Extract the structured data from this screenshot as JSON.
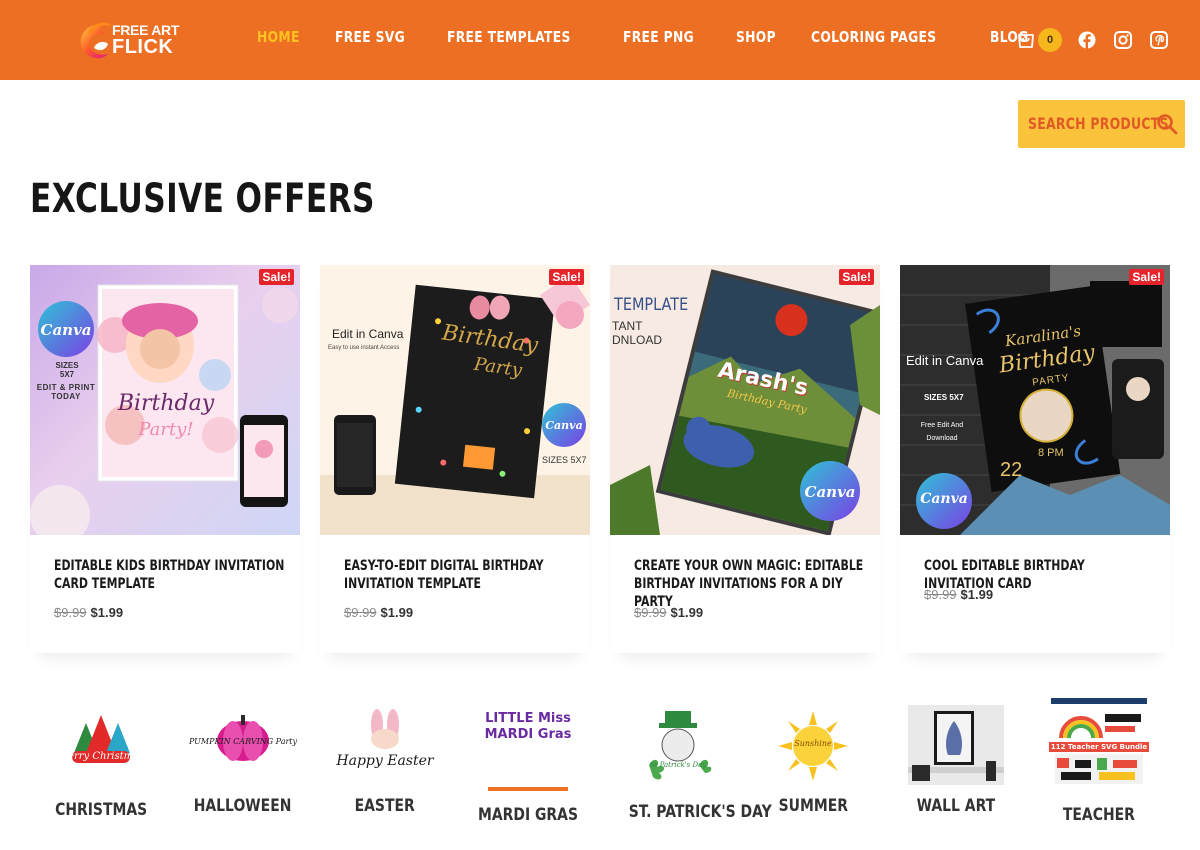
{
  "brand": {
    "name_line1": "FREE ART",
    "name_line2": "FLICK",
    "colors": {
      "header_bg": "#ec6f24",
      "accent": "#ffc21f",
      "search_bg": "#fbc33b",
      "sale": "#e5232a"
    }
  },
  "nav": {
    "items": [
      {
        "label": "HOME",
        "active": true
      },
      {
        "label": "FREE SVG"
      },
      {
        "label": "FREE TEMPLATES"
      },
      {
        "label": "FREE PNG"
      },
      {
        "label": "SHOP"
      },
      {
        "label": "COLORING PAGES"
      },
      {
        "label": "BLOG"
      }
    ]
  },
  "cart": {
    "count": "0",
    "icon": "cart-icon"
  },
  "social": [
    "facebook-icon",
    "instagram-icon",
    "pinterest-icon"
  ],
  "search": {
    "label": "SEARCH PRODUCTS",
    "icon": "search-icon"
  },
  "section": {
    "title": "EXCLUSIVE OFFERS"
  },
  "products": [
    {
      "badge": "Sale!",
      "title": "EDITABLE KIDS BIRTHDAY INVITATION CARD TEMPLATE",
      "old_price": "$9.99",
      "price": "$1.99",
      "image_text": {
        "canva": "Canva",
        "sizes": "SIZES 5X7",
        "edit": "EDIT & PRINT TODAY",
        "headline": "Birthday",
        "sub": "Party!"
      }
    },
    {
      "badge": "Sale!",
      "title": "EASY-TO-EDIT DIGITAL BIRTHDAY INVITATION TEMPLATE",
      "old_price": "$9.99",
      "price": "$1.99",
      "image_text": {
        "edit": "Edit in Canva",
        "note": "Easy to use instant Access",
        "headline": "Birthday",
        "sub": "Party",
        "canva": "Canva",
        "sizes": "SIZES 5X7"
      }
    },
    {
      "badge": "Sale!",
      "title": "CREATE YOUR OWN MAGIC: EDITABLE BIRTHDAY INVITATIONS FOR A DIY PARTY",
      "old_price": "$9.99",
      "price": "$1.99",
      "image_text": {
        "template": "TEMPLATE",
        "tant": "TANT",
        "download": "DNLOAD",
        "name": "Arash's",
        "sub": "Birthday Party",
        "canva": "Canva"
      }
    },
    {
      "badge": "Sale!",
      "title": "COOL EDITABLE BIRTHDAY INVITATION CARD",
      "old_price": "$9.99",
      "price": "$1.99",
      "image_text": {
        "edit": "Edit in Canva",
        "sizes": "SIZES 5X7",
        "free": "Free Edit And Download",
        "name": "Karalina's",
        "headline": "Birthday",
        "sub": "PARTY",
        "date": "22",
        "time": "8 PM",
        "canva": "Canva"
      }
    }
  ],
  "categories": [
    {
      "label": "CHRISTMAS",
      "art_text": "Merry Christmas"
    },
    {
      "label": "HALLOWEEN",
      "art_text": "PUMPKIN CARVING Party"
    },
    {
      "label": "EASTER",
      "art_text": "Happy Easter"
    },
    {
      "label": "MARDI GRAS",
      "art_text": "LITTLE Miss MARDI Gras"
    },
    {
      "label": "ST. PATRICK'S DAY",
      "art_text": "St Patrick's Day"
    },
    {
      "label": "SUMMER",
      "art_text": "Sunshine"
    },
    {
      "label": "WALL ART",
      "art_text": ""
    },
    {
      "label": "TEACHER",
      "art_text": "112 Teacher SVG Bundle"
    }
  ]
}
